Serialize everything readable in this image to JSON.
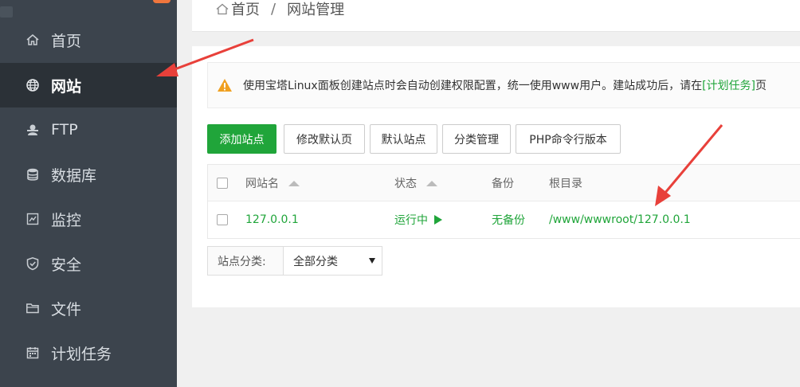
{
  "sidebar": {
    "items": [
      {
        "label": "首页",
        "icon": "home-icon"
      },
      {
        "label": "网站",
        "icon": "globe-icon",
        "active": true
      },
      {
        "label": "FTP",
        "icon": "ftp-user-icon"
      },
      {
        "label": "数据库",
        "icon": "database-icon"
      },
      {
        "label": "监控",
        "icon": "monitor-icon"
      },
      {
        "label": "安全",
        "icon": "shield-icon"
      },
      {
        "label": "文件",
        "icon": "folder-icon"
      },
      {
        "label": "计划任务",
        "icon": "calendar-icon"
      }
    ]
  },
  "breadcrumb": {
    "home": "首页",
    "separator": "/",
    "current": "网站管理"
  },
  "notice": {
    "text": "使用宝塔Linux面板创建站点时会自动创建权限配置，统一使用www用户。建站成功后，请在",
    "link": "[计划任务]",
    "tail": "页"
  },
  "toolbar": {
    "add_site": "添加站点",
    "edit_default_page": "修改默认页",
    "default_site": "默认站点",
    "category_manage": "分类管理",
    "php_cli_version": "PHP命令行版本"
  },
  "table": {
    "headers": {
      "name": "网站名",
      "status": "状态",
      "backup": "备份",
      "root": "根目录"
    },
    "rows": [
      {
        "name": "127.0.0.1",
        "status": "运行中",
        "backup": "无备份",
        "root": "/www/wwwroot/127.0.0.1"
      }
    ]
  },
  "filter": {
    "label": "站点分类:",
    "value": "全部分类"
  },
  "colors": {
    "sidebar": "#3c444d",
    "sidebar_active": "#2b3137",
    "accent": "#20a53a",
    "arrow": "#e8403a"
  }
}
